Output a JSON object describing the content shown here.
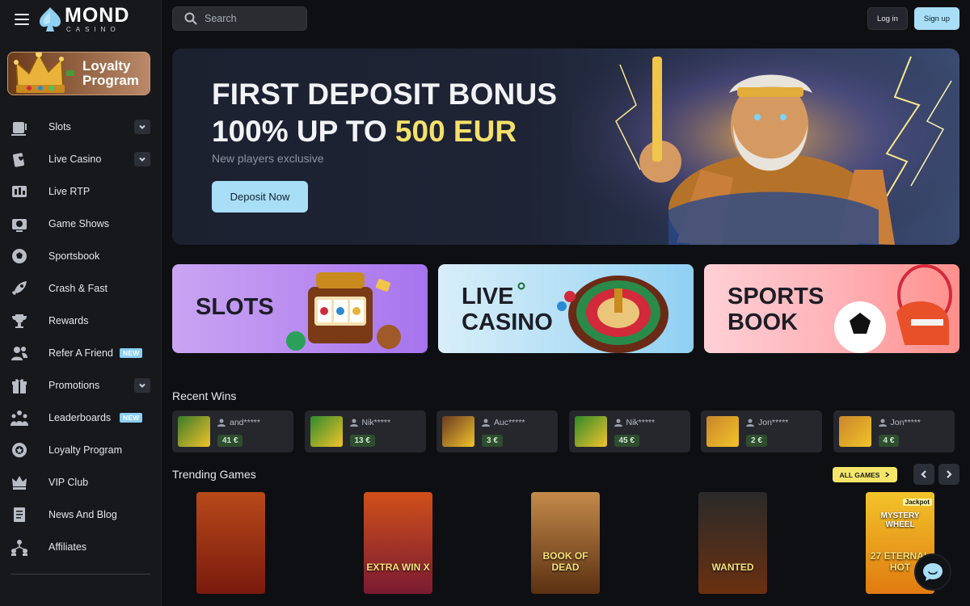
{
  "brand": {
    "name": "MOND",
    "sub": "CASINO"
  },
  "search": {
    "placeholder": "Search"
  },
  "header": {
    "login": "Log in",
    "signup": "Sign up"
  },
  "loyalty_card": {
    "line1": "Loyalty",
    "line2": "Program"
  },
  "nav": [
    {
      "label": "Slots",
      "icon": "slot-machine-icon",
      "chevron": true
    },
    {
      "label": "Live Casino",
      "icon": "playing-cards-icon",
      "chevron": true
    },
    {
      "label": "Live RTP",
      "icon": "live-rtp-icon"
    },
    {
      "label": "Game Shows",
      "icon": "tv-icon"
    },
    {
      "label": "Sportsbook",
      "icon": "soccer-ball-icon"
    },
    {
      "label": "Crash & Fast",
      "icon": "rocket-icon"
    },
    {
      "label": "Rewards",
      "icon": "trophy-icon"
    },
    {
      "label": "Refer A Friend",
      "icon": "refer-friend-icon",
      "badge": "NEW"
    },
    {
      "label": "Promotions",
      "icon": "gift-icon",
      "chevron": true
    },
    {
      "label": "Leaderboards",
      "icon": "leaderboard-icon",
      "badge": "NEW"
    },
    {
      "label": "Loyalty Program",
      "icon": "loyalty-icon"
    },
    {
      "label": "VIP Club",
      "icon": "crown-icon"
    },
    {
      "label": "News And Blog",
      "icon": "document-icon"
    },
    {
      "label": "Affiliates",
      "icon": "affiliates-icon"
    }
  ],
  "hero": {
    "line1": "FIRST DEPOSIT BONUS",
    "line2_prefix": "100% UP TO ",
    "line2_highlight": "500 EUR",
    "subtitle": "New players exclusive",
    "cta": "Deposit Now"
  },
  "categories": [
    {
      "line1": "SLOTS",
      "line2": ""
    },
    {
      "line1": "LIVE",
      "line2": "CASINO"
    },
    {
      "line1": "SPORTS",
      "line2": "BOOK"
    }
  ],
  "recent_wins": {
    "title": "Recent Wins",
    "items": [
      {
        "user": "and*****",
        "amount": "41 €",
        "thumb": "#3a7a2a"
      },
      {
        "user": "Nik*****",
        "amount": "13 €",
        "thumb": "#2f8a2a"
      },
      {
        "user": "Auc*****",
        "amount": "3 €",
        "thumb": "#6a3a22"
      },
      {
        "user": "Nik*****",
        "amount": "45 €",
        "thumb": "#2f8a2a"
      },
      {
        "user": "Jon*****",
        "amount": "2 €",
        "thumb": "#c9852a"
      },
      {
        "user": "Jon*****",
        "amount": "4 €",
        "thumb": "#c9852a"
      }
    ]
  },
  "trending": {
    "title": "Trending Games",
    "all_games": "ALL GAMES",
    "games": [
      {
        "title": "",
        "top": "#b84a1a",
        "bottom": "#7a1a0e"
      },
      {
        "title": "EXTRA WIN X",
        "top": "#d0501a",
        "bottom": "#7a1a32"
      },
      {
        "title": "BOOK OF DEAD",
        "top": "#c48a4a",
        "bottom": "#5a3012"
      },
      {
        "title": "WANTED",
        "top": "#2a2a2a",
        "bottom": "#6a3010"
      },
      {
        "title": "27 ETERNAL HOT",
        "top": "#f2c42a",
        "bottom": "#e07a10"
      }
    ],
    "jackpot_label": "Jackpot",
    "mystery_label": "MYSTERY WHEEL"
  }
}
